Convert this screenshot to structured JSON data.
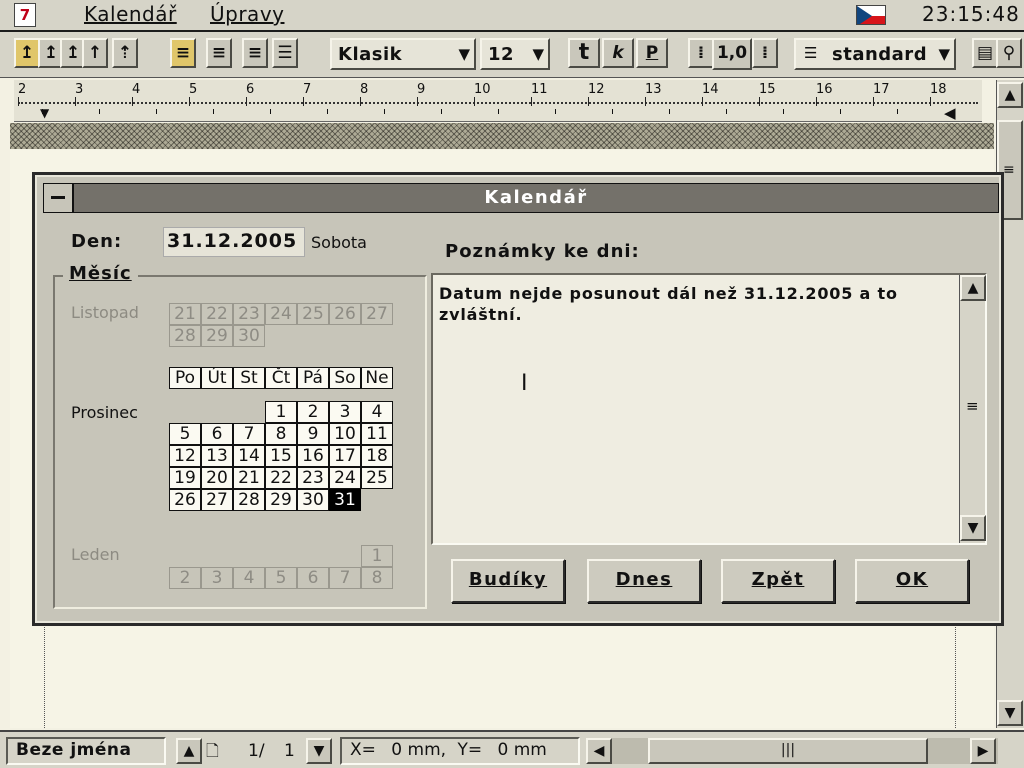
{
  "menubar": {
    "app_icon": "7",
    "menus": [
      "Kalendář",
      "Úpravy"
    ],
    "flag_icon": "czech-flag-icon",
    "clock": "23:15:48"
  },
  "toolbar": {
    "font_name": "Klasik",
    "font_size": "12",
    "bold": "t",
    "italic": "k",
    "underline": "P",
    "line_spacing": "1,0",
    "style": "standard"
  },
  "ruler": {
    "numbers": [
      "2",
      "3",
      "4",
      "5",
      "6",
      "7",
      "8",
      "9",
      "10",
      "11",
      "12",
      "13",
      "14",
      "15",
      "16",
      "17",
      "18"
    ]
  },
  "dialog": {
    "title": "Kalendář",
    "den_label": "Den:",
    "date_value": "31.12.2005",
    "weekday": "Sobota",
    "month_group_label": "Měsíc",
    "notes_label": "Poznámky ke dni:",
    "notes_text": "Datum nejde posunout dál než 31.12.2005 a to\nzvláštní.",
    "prev_month": {
      "name": "Listopad",
      "days": [
        "21",
        "22",
        "23",
        "24",
        "25",
        "26",
        "27",
        "28",
        "29",
        "30"
      ]
    },
    "current_month": {
      "name": "Prosinec",
      "weekday_headers": [
        "Po",
        "Út",
        "St",
        "Čt",
        "Pá",
        "So",
        "Ne"
      ],
      "days": [
        "1",
        "2",
        "3",
        "4",
        "5",
        "6",
        "7",
        "8",
        "9",
        "10",
        "11",
        "12",
        "13",
        "14",
        "15",
        "16",
        "17",
        "18",
        "19",
        "20",
        "21",
        "22",
        "23",
        "24",
        "25",
        "26",
        "27",
        "28",
        "29",
        "30",
        "31"
      ],
      "selected_day": "31"
    },
    "next_month": {
      "name": "Leden",
      "days": [
        "1",
        "2",
        "3",
        "4",
        "5",
        "6",
        "7",
        "8"
      ]
    },
    "buttons": {
      "alarms": "Budíky",
      "today": "Dnes",
      "back": "Zpět",
      "ok": "OK"
    }
  },
  "statusbar": {
    "document_name": "Beze jména",
    "page_current": "1/",
    "page_total": "1",
    "x_label": "X=",
    "x_value": "0 mm,",
    "y_label": "Y=",
    "y_value": "0 mm"
  },
  "colors": {
    "background": "#f3f1e3",
    "chrome": "#d6d4c8",
    "dialog": "#c7c5b9",
    "titlebar": "#74716a",
    "selected_day": "#000000"
  }
}
